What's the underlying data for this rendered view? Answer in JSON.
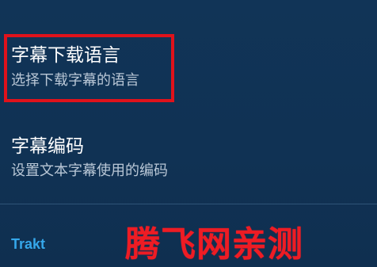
{
  "settings": {
    "subtitle_language": {
      "title": "字幕下载语言",
      "summary": "选择下载字幕的语言"
    },
    "subtitle_encoding": {
      "title": "字幕编码",
      "summary": "设置文本字幕使用的编码"
    },
    "category": "Trakt"
  },
  "watermark": "腾飞网亲测",
  "colors": {
    "background": "#0f3254",
    "highlight": "#e0121b",
    "accent": "#35a7ea",
    "watermark": "#ee1c24"
  }
}
